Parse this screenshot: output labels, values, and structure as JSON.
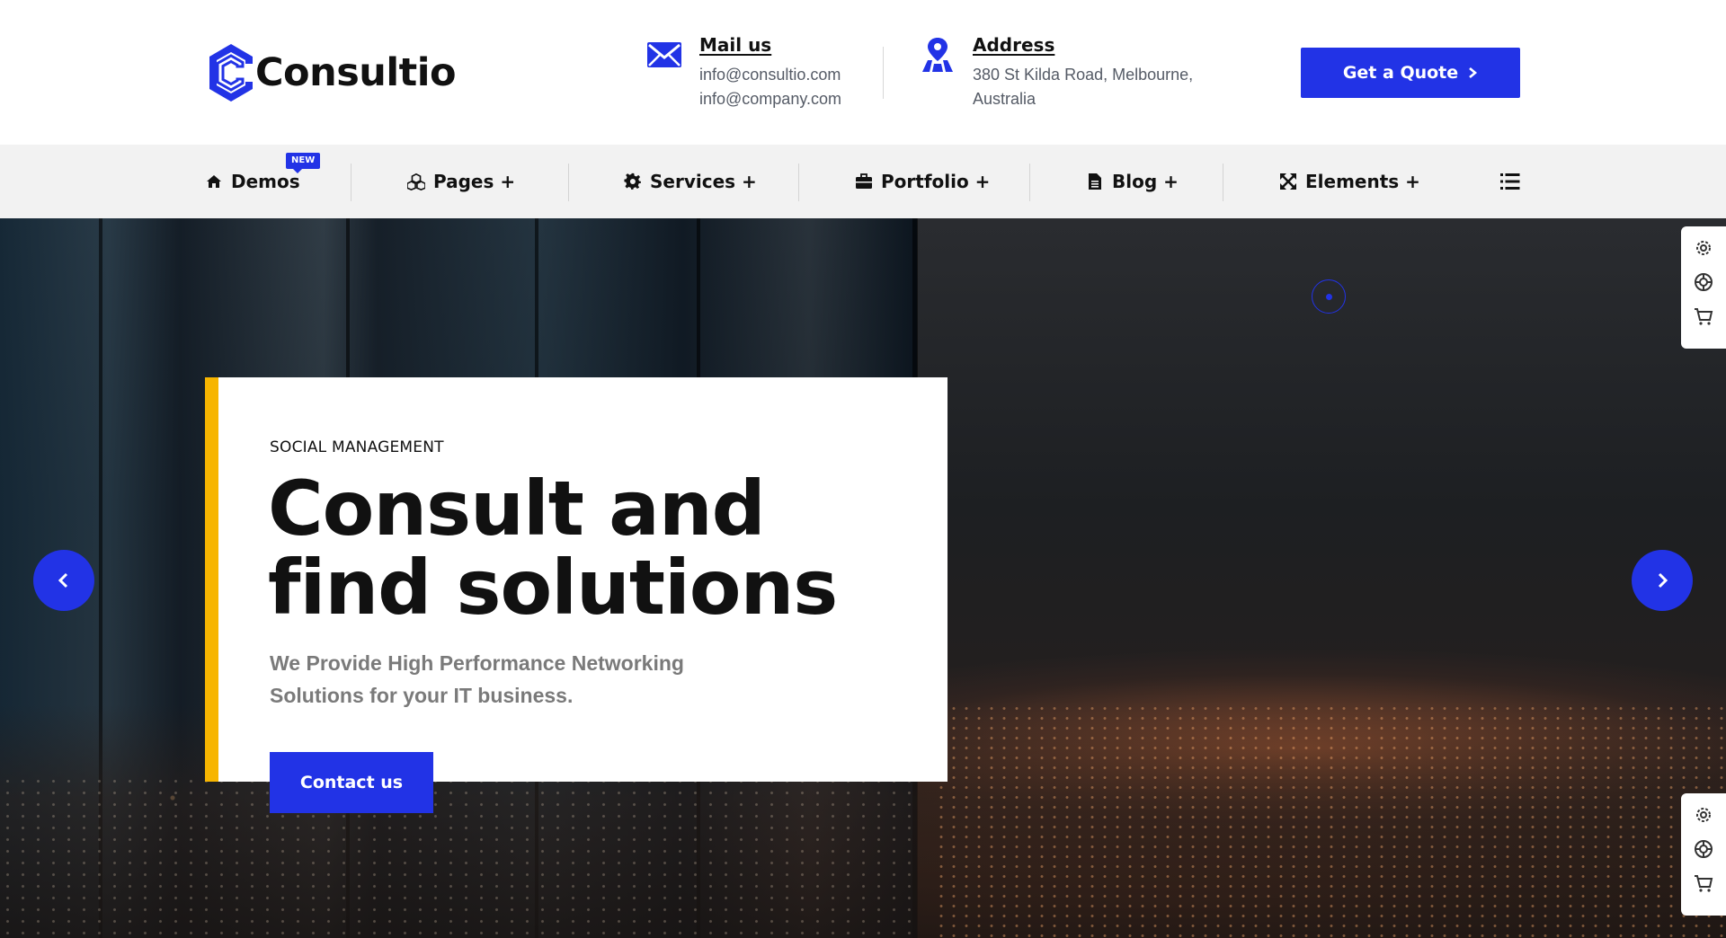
{
  "brand": {
    "name": "Consultio",
    "accent": "#2233e6",
    "highlight": "#f7b500"
  },
  "contact": {
    "mail_title": "Mail us",
    "mail_lines": [
      "info@consultio.com",
      "info@company.com"
    ],
    "address_title": "Address",
    "address_lines": [
      "380 St Kilda Road, Melbourne,",
      "Australia"
    ]
  },
  "header": {
    "quote_label": "Get a Quote"
  },
  "nav": {
    "badge": "NEW",
    "items": [
      {
        "label": "Demos",
        "icon": "home-icon"
      },
      {
        "label": "Pages +",
        "icon": "cubes-icon"
      },
      {
        "label": "Services +",
        "icon": "gear-icon"
      },
      {
        "label": "Portfolio +",
        "icon": "briefcase-icon"
      },
      {
        "label": "Blog +",
        "icon": "document-icon"
      },
      {
        "label": "Elements +",
        "icon": "expand-icon"
      }
    ],
    "menu_icon": "list-icon"
  },
  "hero": {
    "eyebrow": "SOCIAL MANAGEMENT",
    "headline_1": "Consult and",
    "headline_2": "find solutions",
    "sub_1": "We Provide High Performance Networking",
    "sub_2": "Solutions for your IT business.",
    "cta_label": "Contact us"
  },
  "side_tools": [
    "gear-icon",
    "lifebuoy-icon",
    "cart-icon"
  ]
}
